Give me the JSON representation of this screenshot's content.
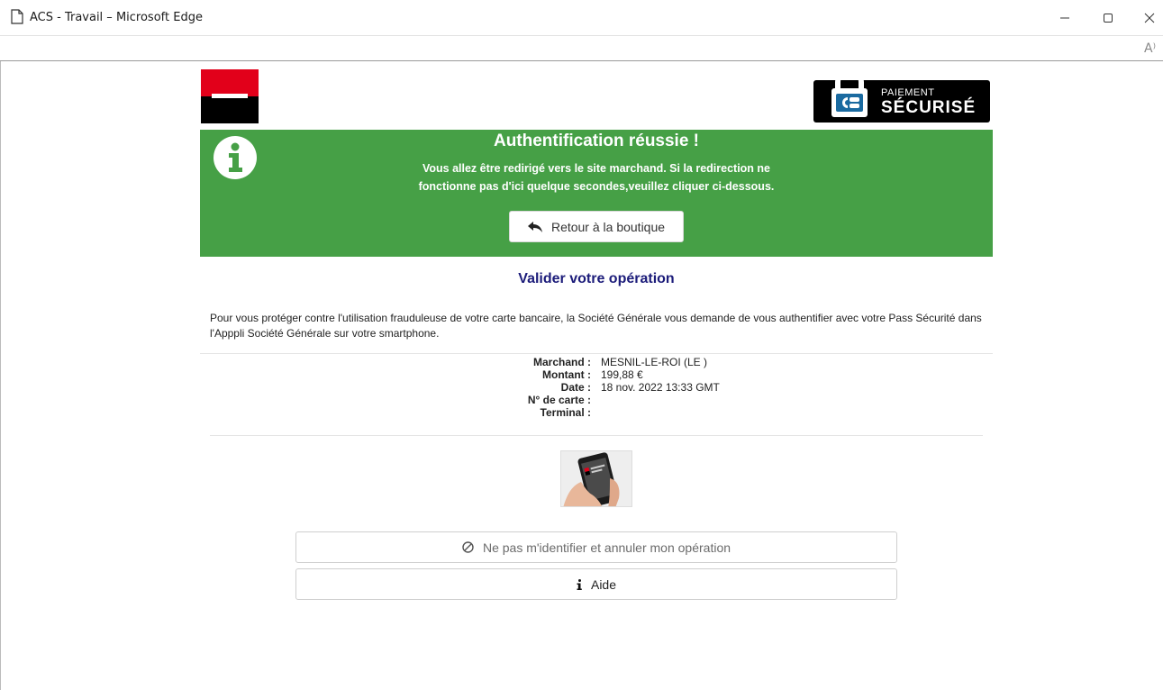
{
  "window": {
    "title": "ACS - Travail – Microsoft Edge",
    "read_aloud": "A⁾"
  },
  "brand": {
    "sg_red": "#e2001a",
    "sg_black": "#000000",
    "cb_line1": "PAIEMENT",
    "cb_line2": "SÉCURISÉ",
    "success_green": "#46a046",
    "title_navy": "#1c1c7a"
  },
  "success": {
    "title": "Authentification réussie !",
    "message": "Vous allez être redirigé vers le site marchand. Si la redirection ne fonctionne pas d'ici quelque secondes,veuillez cliquer ci-dessous.",
    "back_label": "Retour à la boutique"
  },
  "operation": {
    "title": "Valider votre opération",
    "intro": "Pour vous protéger contre l'utilisation frauduleuse de votre carte bancaire, la Société Générale vous demande de vous authentifier avec votre Pass Sécurité dans l'Apppli Société Générale sur votre smartphone.",
    "details": [
      {
        "label": "Marchand :",
        "value": "MESNIL-LE-ROI (LE )"
      },
      {
        "label": "Montant :",
        "value": "199,88 €"
      },
      {
        "label": "Date :",
        "value": "18 nov. 2022 13:33 GMT"
      },
      {
        "label": "N° de carte :",
        "value": ""
      },
      {
        "label": "Terminal :",
        "value": ""
      }
    ]
  },
  "actions": {
    "cancel_label": "Ne pas m'identifier et annuler mon opération",
    "help_label": "Aide"
  }
}
